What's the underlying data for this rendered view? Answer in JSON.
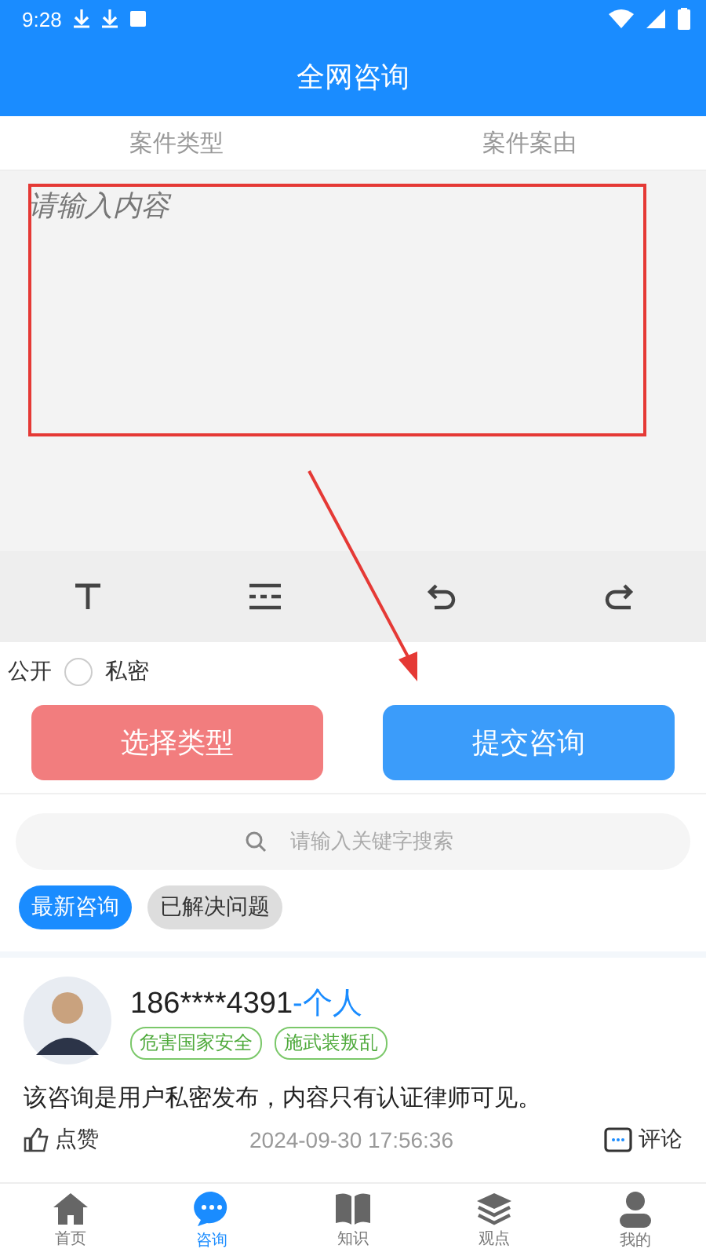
{
  "status_bar": {
    "time": "9:28"
  },
  "window": {
    "title": "全网咨询"
  },
  "tabs": [
    {
      "label": "案件类型",
      "selected": false
    },
    {
      "label": "案件案由",
      "selected": false
    }
  ],
  "editor": {
    "placeholder": "请输入内容"
  },
  "toolbar": [
    {
      "kind": "text"
    },
    {
      "kind": "list"
    },
    {
      "kind": "undo"
    },
    {
      "kind": "redo"
    }
  ],
  "visibility": {
    "label": "公开",
    "option": {
      "label": "私密",
      "selected": false
    }
  },
  "buttons": [
    {
      "label": "选择类型",
      "kind": "type"
    },
    {
      "label": "提交咨询",
      "kind": "submit"
    }
  ],
  "search": {
    "placeholder": "请输入关键字搜索"
  },
  "filters": [
    {
      "label": "最新咨询",
      "selected": true
    },
    {
      "label": "已解决问题",
      "selected": false
    }
  ],
  "post": {
    "name": "186****4391",
    "role": "-个人",
    "tags": [
      "危害国家安全",
      "施武装叛乱"
    ],
    "text": "该咨询是用户私密发布，内容只有认证律师可见。",
    "like": "点赞",
    "time": "2024-09-30 17:56:36",
    "comment": "评论"
  },
  "nav": [
    {
      "label": "首页",
      "kind": "home",
      "selected": false
    },
    {
      "label": "咨询",
      "kind": "chat",
      "selected": true
    },
    {
      "label": "知识",
      "kind": "book",
      "selected": false
    },
    {
      "label": "观点",
      "kind": "layers",
      "selected": false
    },
    {
      "label": "我的",
      "kind": "user",
      "selected": false
    }
  ]
}
